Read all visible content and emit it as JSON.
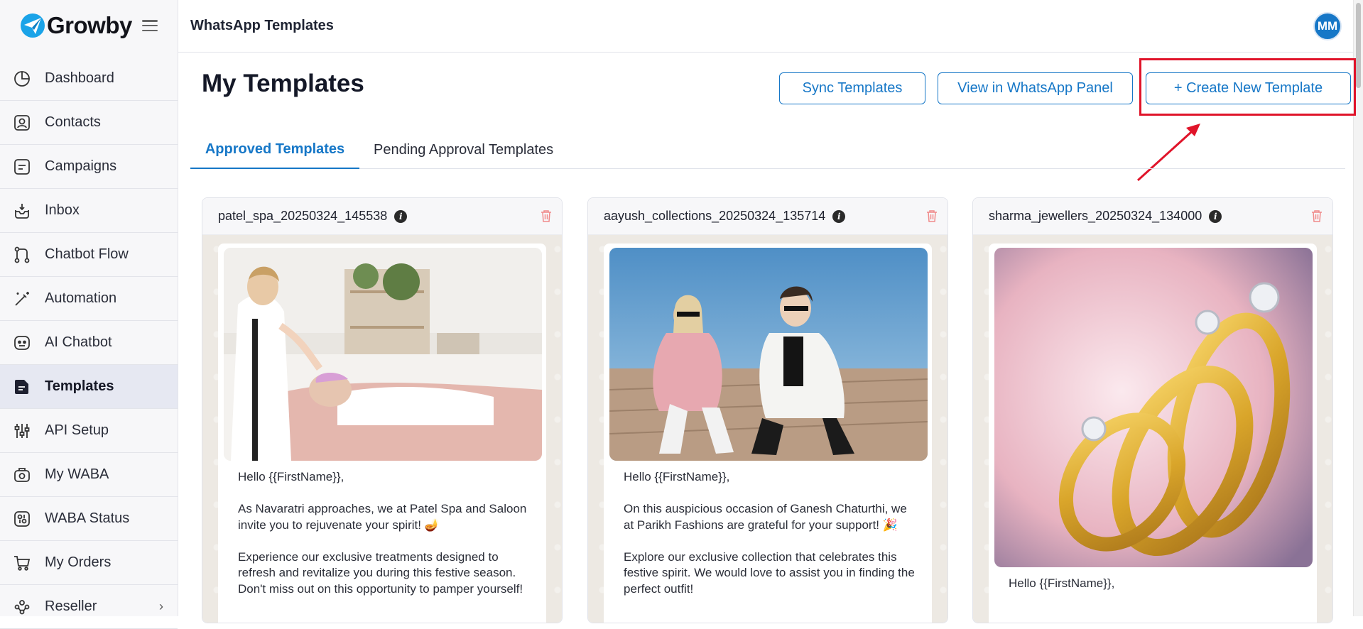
{
  "brand": {
    "name": "Growby"
  },
  "sidebar": {
    "items": [
      {
        "label": "Dashboard",
        "icon": "dashboard-icon"
      },
      {
        "label": "Contacts",
        "icon": "contacts-icon"
      },
      {
        "label": "Campaigns",
        "icon": "campaigns-icon"
      },
      {
        "label": "Inbox",
        "icon": "inbox-icon"
      },
      {
        "label": "Chatbot Flow",
        "icon": "flow-icon"
      },
      {
        "label": "Automation",
        "icon": "magic-wand-icon"
      },
      {
        "label": "AI Chatbot",
        "icon": "robot-icon"
      },
      {
        "label": "Templates",
        "icon": "template-icon",
        "active": true
      },
      {
        "label": "API Setup",
        "icon": "sliders-icon"
      },
      {
        "label": "My WABA",
        "icon": "waba-icon"
      },
      {
        "label": "WABA Status",
        "icon": "status-icon"
      },
      {
        "label": "My Orders",
        "icon": "cart-icon"
      },
      {
        "label": "Reseller",
        "icon": "reseller-icon"
      }
    ]
  },
  "header": {
    "title": "WhatsApp Templates",
    "avatar_initials": "MM"
  },
  "main": {
    "page_title": "My Templates",
    "buttons": {
      "sync": "Sync Templates",
      "view_panel": "View in WhatsApp Panel",
      "create": "+ Create New Template"
    },
    "tabs": [
      {
        "label": "Approved Templates",
        "active": true
      },
      {
        "label": "Pending Approval Templates",
        "active": false
      }
    ],
    "cards": [
      {
        "name": "patel_spa_20250324_145538",
        "image": "spa-treatment-photo",
        "message": "Hello {{FirstName}},\n\nAs Navaratri approaches, we at Patel Spa and Saloon invite you to rejuvenate your spirit! 🪔\n\nExperience our exclusive treatments designed to refresh and revitalize you during this festive season. Don't miss out on this opportunity to pamper yourself!"
      },
      {
        "name": "aayush_collections_20250324_135714",
        "image": "fashion-models-photo",
        "message": "Hello {{FirstName}},\n\nOn this auspicious occasion of Ganesh Chaturthi, we at Parikh Fashions are grateful for your support! 🎉\n\nExplore our exclusive collection that celebrates this festive spirit. We would love to assist you in finding the perfect outfit!"
      },
      {
        "name": "sharma_jewellers_20250324_134000",
        "image": "gold-rings-photo",
        "message": "Hello {{FirstName}},"
      }
    ]
  },
  "colors": {
    "accent": "#1677c7",
    "highlight": "#e0142a"
  }
}
